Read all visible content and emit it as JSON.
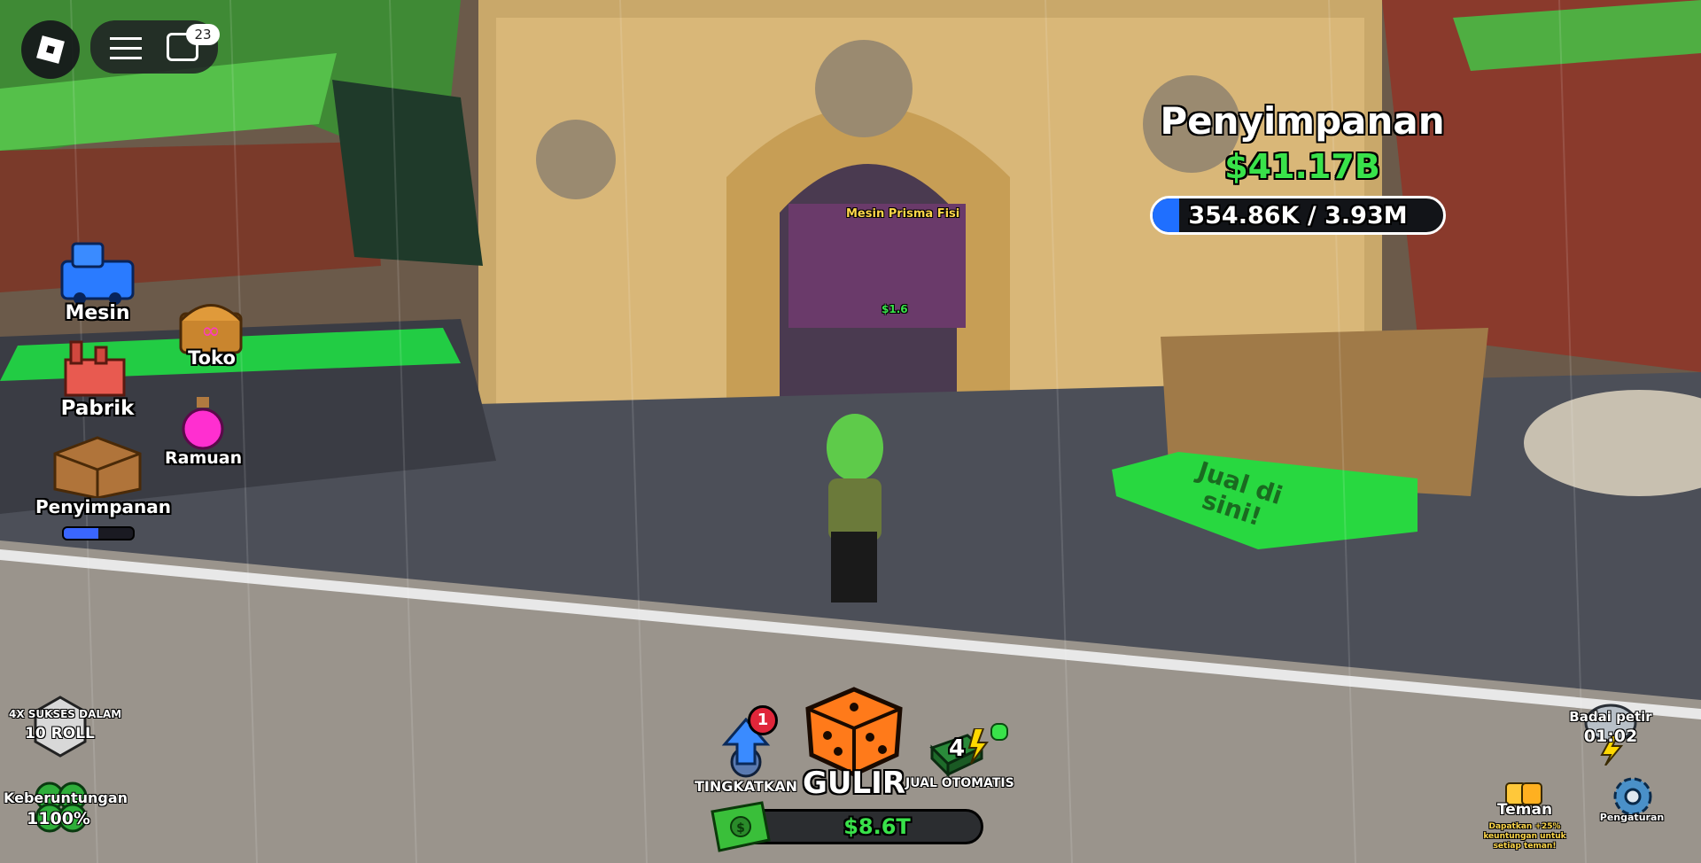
{
  "topbar": {
    "chat_badge": "23"
  },
  "left_menu": {
    "items": [
      {
        "label": "Mesin"
      },
      {
        "label": "Toko"
      },
      {
        "label": "Pabrik"
      },
      {
        "label": "Ramuan"
      },
      {
        "label": "Penyimpanan"
      }
    ],
    "storage_progress": 0.5
  },
  "storage_display": {
    "title": "Penyimpanan",
    "money": "$41.17B",
    "capacity": "354.86K / 3.93M",
    "progress": 0.09
  },
  "machine_sign": {
    "title": "Mesin Prisma Fisi",
    "price": "$1.6"
  },
  "floor_text": "Jual di sini!",
  "boosts": {
    "roll_title": "4X SUKSES DALAM",
    "roll_value": "10 ROLL",
    "luck_title": "Keberuntungan",
    "luck_value": "1100%"
  },
  "bottom_bar": {
    "upgrade_label": "TINGKATKAN",
    "upgrade_badge": "1",
    "roll_label": "GULIR",
    "autosell_label": "JUAL OTOMATIS",
    "autosell_count": "4",
    "cash": "$8.6T"
  },
  "weather": {
    "label": "Badai petir",
    "timer": "01:02"
  },
  "friends": {
    "label": "Teman",
    "note": "Dapatkan +25% keuntungan untuk setiap teman!"
  },
  "settings": {
    "label": "Pengaturan"
  },
  "colors": {
    "money_green": "#39e24a",
    "progress_blue": "#1f6fff",
    "dice_orange": "#ff7a1a",
    "badge_red": "#e0263a"
  }
}
